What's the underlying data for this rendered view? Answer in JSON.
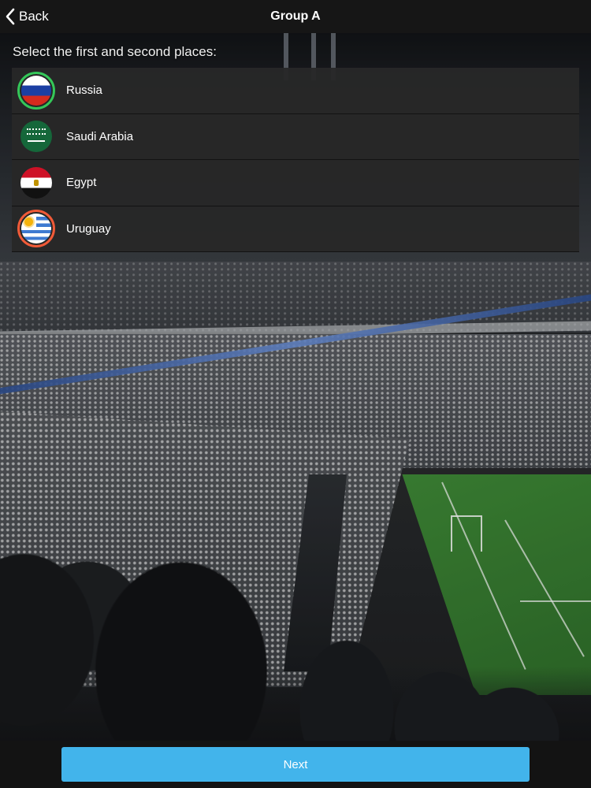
{
  "header": {
    "back_label": "Back",
    "title": "Group A"
  },
  "instruction": "Select the first and second places:",
  "teams": [
    {
      "name": "Russia",
      "flag_icon": "russia-flag-icon",
      "selection": "first",
      "ring_color": "#34c759"
    },
    {
      "name": "Saudi Arabia",
      "flag_icon": "saudi-arabia-flag-icon",
      "selection": "none"
    },
    {
      "name": "Egypt",
      "flag_icon": "egypt-flag-icon",
      "selection": "none"
    },
    {
      "name": "Uruguay",
      "flag_icon": "uruguay-flag-icon",
      "selection": "second",
      "ring_color": "#f05a38"
    }
  ],
  "footer": {
    "next_label": "Next"
  },
  "colors": {
    "accent": "#42b4eb",
    "first_place": "#34c759",
    "second_place": "#f05a38"
  }
}
